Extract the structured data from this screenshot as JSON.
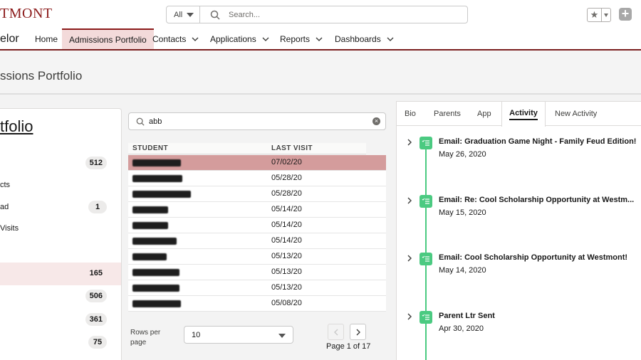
{
  "header": {
    "logo": "TMONT",
    "search_scope": "All",
    "search_placeholder": "Search..."
  },
  "nav": {
    "app_name": "elor",
    "items": [
      {
        "label": "Home"
      },
      {
        "label": "Admissions Portfolio"
      },
      {
        "label": "Contacts"
      },
      {
        "label": "Applications"
      },
      {
        "label": "Reports"
      },
      {
        "label": "Dashboards"
      }
    ]
  },
  "page": {
    "title": "ssions Portfolio"
  },
  "left": {
    "title": "tfolio",
    "items": [
      {
        "label": "",
        "count": "512"
      },
      {
        "label": "cts",
        "count": ""
      },
      {
        "label": "ad",
        "count": "1"
      },
      {
        "label": "Visits",
        "count": ""
      },
      {
        "label": "",
        "count": "165"
      },
      {
        "label": "",
        "count": "506"
      },
      {
        "label": "",
        "count": "361"
      },
      {
        "label": "",
        "count": "75"
      }
    ]
  },
  "grid": {
    "filter_value": "abb",
    "col_student": "STUDENT",
    "col_last_visit": "LAST VISIT",
    "rows": [
      {
        "date": "07/02/20"
      },
      {
        "date": "05/28/20"
      },
      {
        "date": "05/28/20"
      },
      {
        "date": "05/14/20"
      },
      {
        "date": "05/14/20"
      },
      {
        "date": "05/14/20"
      },
      {
        "date": "05/13/20"
      },
      {
        "date": "05/13/20"
      },
      {
        "date": "05/13/20"
      },
      {
        "date": "05/08/20"
      }
    ],
    "rows_per_page_label": "Rows per page",
    "rows_per_page_value": "10",
    "page_label": "Page 1 of 17"
  },
  "right": {
    "tabs": [
      {
        "label": "Bio"
      },
      {
        "label": "Parents"
      },
      {
        "label": "App"
      },
      {
        "label": "Activity"
      },
      {
        "label": "New Activity"
      }
    ],
    "activities": [
      {
        "subject": "Email: Graduation Game Night - Family Feud Edition!",
        "date": "May 26, 2020"
      },
      {
        "subject": "Email: Re: Cool Scholarship Opportunity at Westm...",
        "date": "May 15, 2020"
      },
      {
        "subject": "Email: Cool Scholarship Opportunity at Westmont!",
        "date": "May 14, 2020"
      },
      {
        "subject": "Parent Ltr Sent",
        "date": "Apr 30, 2020"
      }
    ]
  },
  "colors": {
    "brand": "#8b1a1a",
    "selected_row": "#d49c9c",
    "timeline": "#4bca81"
  }
}
